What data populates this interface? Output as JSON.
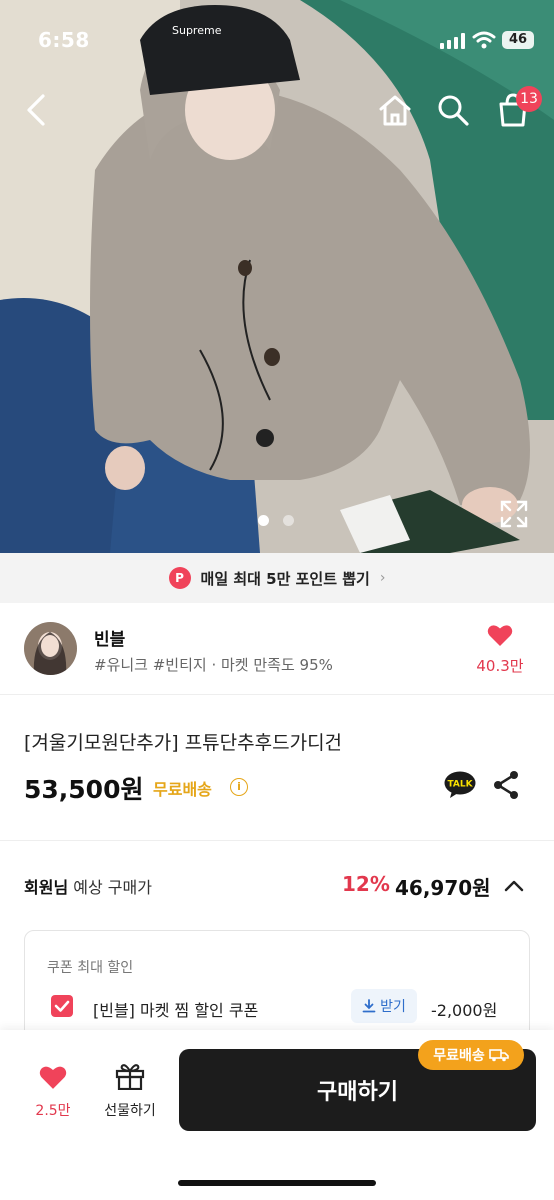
{
  "status_bar": {
    "time": "6:58",
    "battery": "46"
  },
  "header": {
    "cart_count": "13"
  },
  "gallery": {
    "current_index": 1,
    "total": 2
  },
  "banner": {
    "badge": "P",
    "text": "매일 최대 5만 포인트 뽑기"
  },
  "seller": {
    "name": "빈블",
    "tags": "#유니크 #빈티지 · 마켓 만족도 95%",
    "like_count": "40.3만"
  },
  "product": {
    "title": "[겨울기모원단추가] 프튜단추후드가디건",
    "price": "53,500원",
    "shipping": "무료배송",
    "talk_label": "TALK"
  },
  "member_price": {
    "label_bold": "회원님",
    "label": " 예상 구매가",
    "discount_pct": "12%",
    "price": "46,970원"
  },
  "coupon": {
    "heading": "쿠폰 최대 할인",
    "name": "[빈블] 마켓 찜 할인 쿠폰",
    "receive_label": "받기",
    "discount": "-2,000원"
  },
  "bottom_bar": {
    "wish_count": "2.5만",
    "gift_label": "선물하기",
    "buy_label": "구매하기",
    "shipping_badge": "무료배송"
  },
  "colors": {
    "accent": "#f0435a",
    "shipping": "#f3a21c",
    "buy": "#1c1c1c"
  },
  "icons": [
    "back-icon",
    "home-icon",
    "search-icon",
    "cart-icon",
    "expand-icon",
    "chevron-right-icon",
    "heart-icon",
    "info-icon",
    "talk-icon",
    "share-icon",
    "chevron-up-icon",
    "checkbox-icon",
    "download-icon",
    "gift-icon",
    "truck-icon"
  ]
}
